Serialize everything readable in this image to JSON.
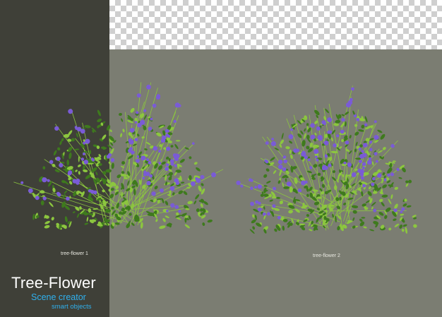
{
  "scene": {
    "title": "Tree-Flower",
    "subtitle": "Scene creator",
    "tagline": "smart objects",
    "objects": [
      {
        "label": "tree-flower 1"
      },
      {
        "label": "tree-flower 2"
      }
    ]
  },
  "colors": {
    "dark_panel": "#3f4038",
    "gray_background": "#7b7d72",
    "checker_light": "#ffffff",
    "checker_dark": "#cfcfcf",
    "title_text": "#ffffff",
    "accent_blue": "#2fb0ee",
    "leaf_dark": "#3e7a1d",
    "leaf_light": "#8cc63f",
    "flower_violet": "#7a5bd6"
  }
}
